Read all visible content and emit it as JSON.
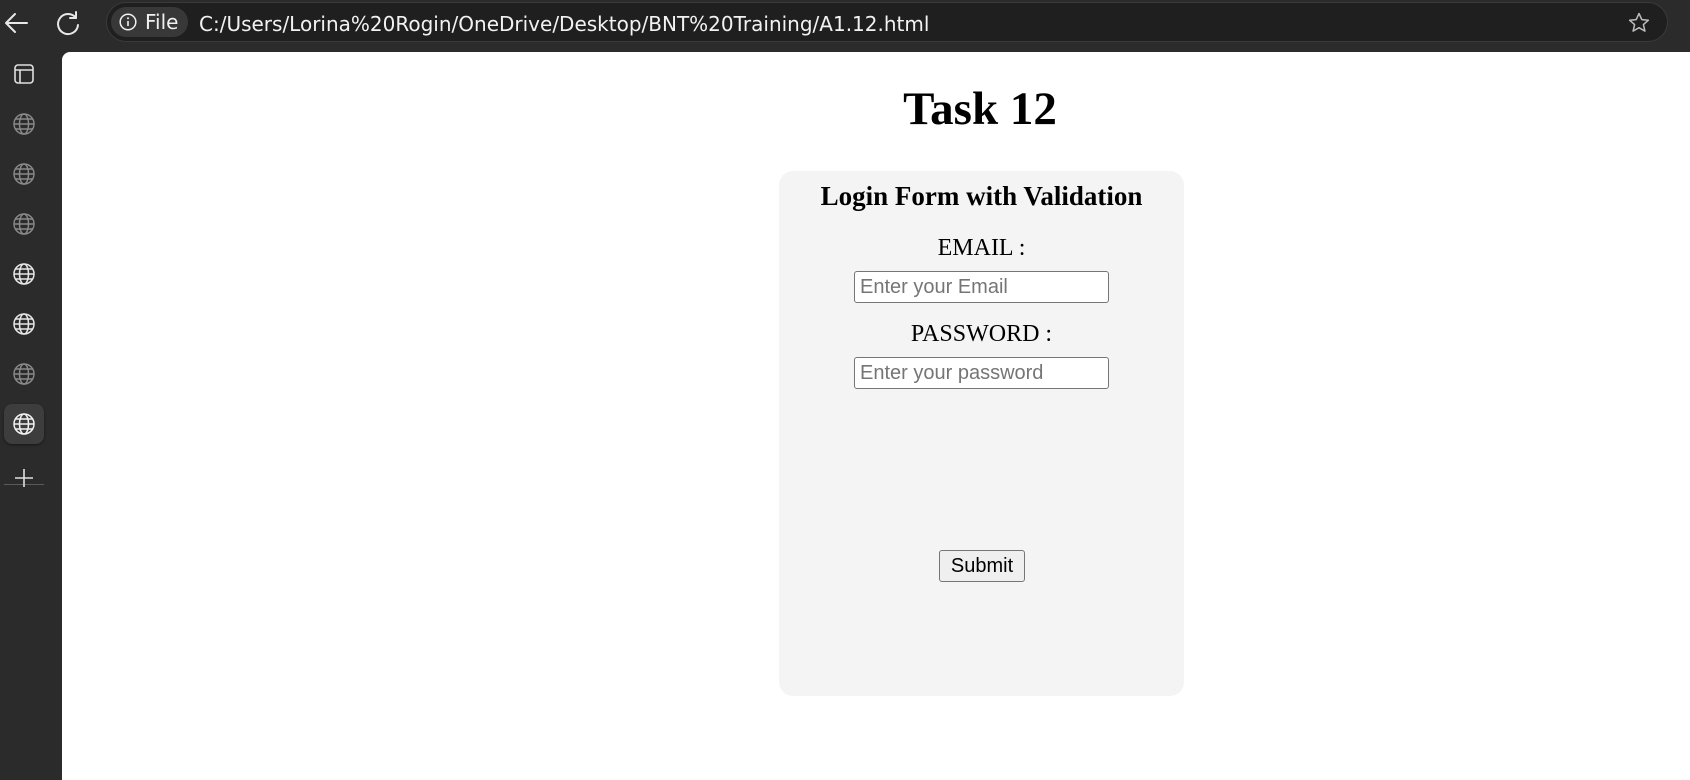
{
  "browser": {
    "site_info_label": "File",
    "url": "C:/Users/Lorina%20Rogin/OneDrive/Desktop/BNT%20Training/A1.12.html",
    "colors": {
      "chrome_bg": "#2b2b2b",
      "address_bg": "#1f1f1f",
      "icon": "#e8e8e8"
    }
  },
  "sidebar": {
    "icons": [
      "tab-actions-icon",
      "globe-icon",
      "globe-icon",
      "globe-icon",
      "globe-icon",
      "globe-icon",
      "globe-icon",
      "globe-icon",
      "plus-icon"
    ]
  },
  "page": {
    "title": "Task 12",
    "form": {
      "heading": "Login Form with Validation",
      "email_label": "EMAIL :",
      "email_placeholder": "Enter your Email",
      "email_value": "",
      "password_label": "PASSWORD :",
      "password_placeholder": "Enter your password",
      "password_value": "",
      "submit_label": "Submit",
      "card_bg": "#f4f4f4"
    }
  }
}
